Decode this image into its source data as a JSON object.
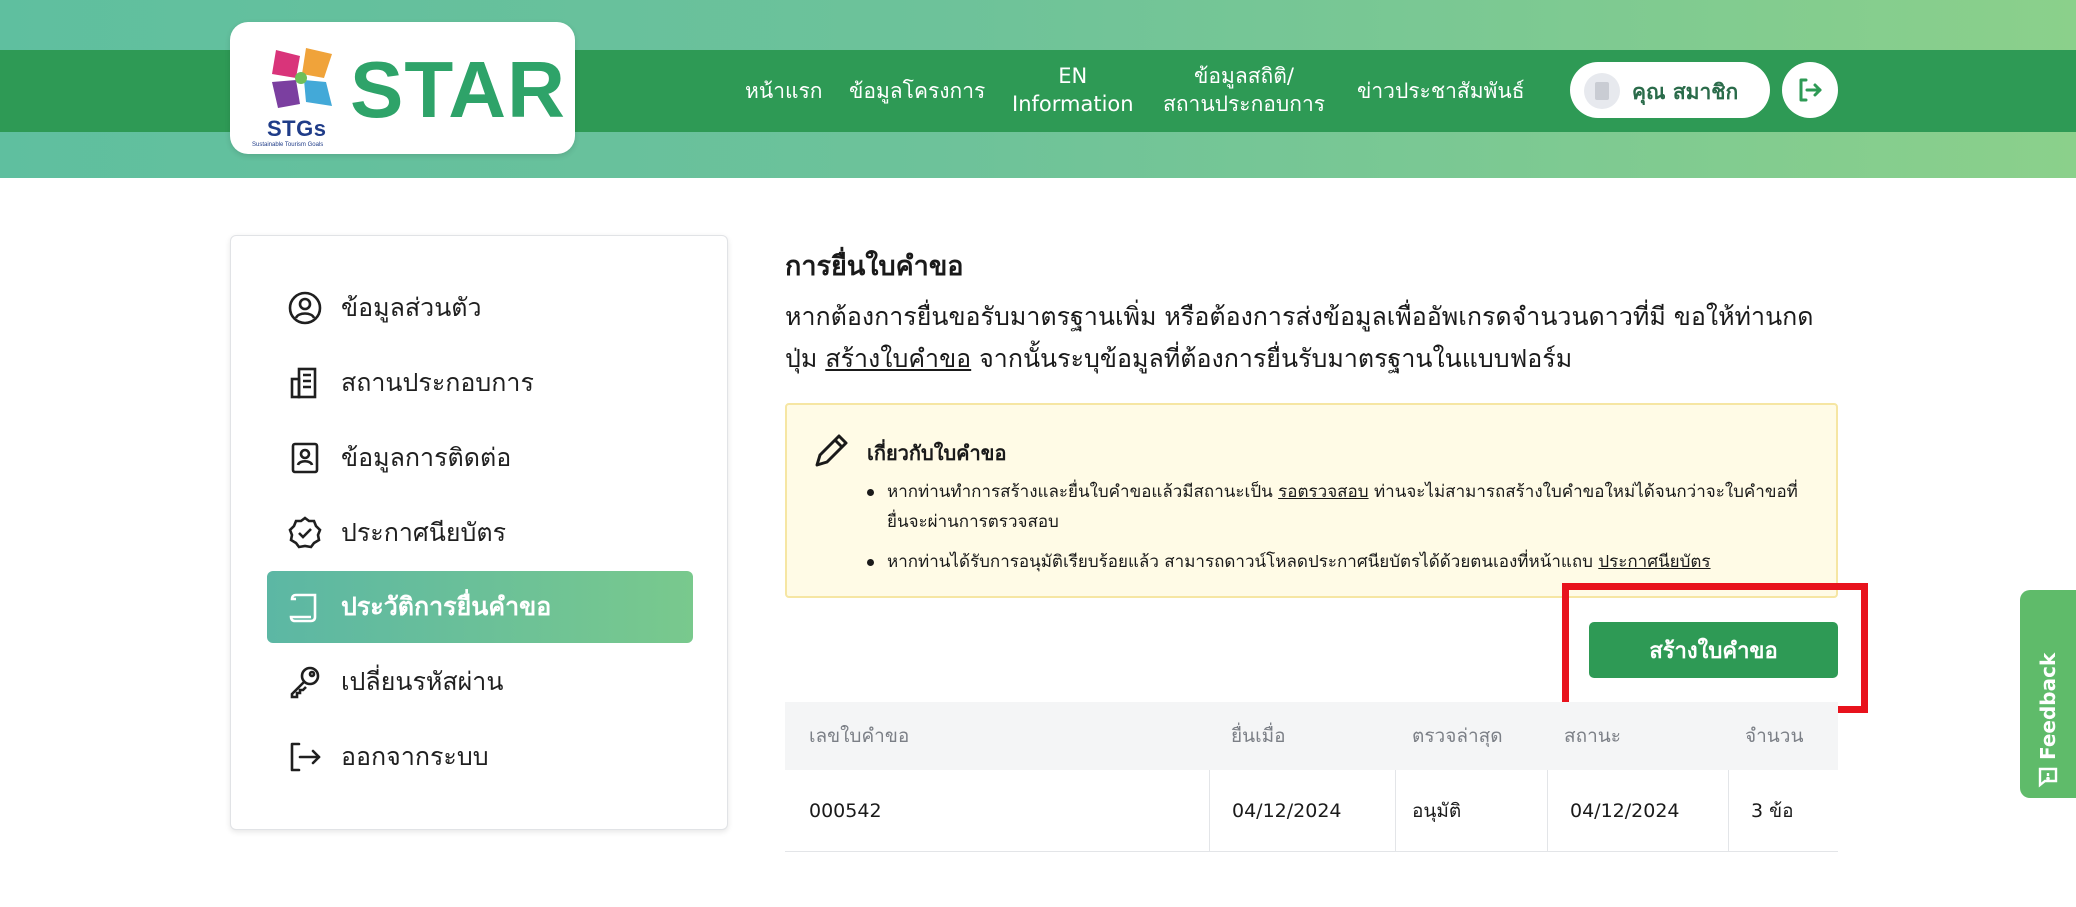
{
  "colors": {
    "brand_green": "#2e9a55",
    "active_gradient_start": "#5cb7a4",
    "highlight_red": "#e8121c",
    "notice_bg": "#fffbe6"
  },
  "logo": {
    "brand_text": "STAR",
    "sub_text": "STGs",
    "tagline": "Sustainable Tourism Goals"
  },
  "nav": {
    "home": "หน้าแรก",
    "project_info": "ข้อมูลโครงการ",
    "en_line1": "EN",
    "en_line2": "Information",
    "stats_line1": "ข้อมูลสถิติ/",
    "stats_line2": "สถานประกอบการ",
    "news": "ข่าวประชาสัมพันธ์"
  },
  "user": {
    "name": "คุณ สมาชิก",
    "avatar_icon": "id-card-icon",
    "logout_icon": "logout-icon"
  },
  "sidebar": {
    "items": [
      {
        "label": "ข้อมูลส่วนตัว",
        "icon": "user-circle-icon"
      },
      {
        "label": "สถานประกอบการ",
        "icon": "building-icon"
      },
      {
        "label": "ข้อมูลการติดต่อ",
        "icon": "contact-book-icon"
      },
      {
        "label": "ประกาศนียบัตร",
        "icon": "certificate-badge-icon"
      },
      {
        "label": "ประวัติการยื่นคำขอ",
        "icon": "scroll-icon",
        "active": true
      },
      {
        "label": "เปลี่ยนรหัสผ่าน",
        "icon": "key-icon"
      },
      {
        "label": "ออกจากระบบ",
        "icon": "logout-icon"
      }
    ]
  },
  "main": {
    "title": "การยื่นใบคำขอ",
    "desc_part1": "หากต้องการยื่นขอรับมาตรฐานเพิ่ม หรือต้องการส่งข้อมูลเพื่ออัพเกรดจำนวนดาวที่มี ขอให้ท่านกดปุ่ม",
    "desc_link": "สร้างใบคำขอ",
    "desc_part2": " จากนั้นระบุข้อมูลที่ต้องการยื่นรับมาตรฐานในแบบฟอร์ม"
  },
  "notice": {
    "title": "เกี่ยวกับใบคำขอ",
    "item1_a": "หากท่านทำการสร้างและยื่นใบคำขอแล้วมีสถานะเป็น ",
    "item1_link": "รอตรวจสอบ",
    "item1_b": " ท่านจะไม่สามารถสร้างใบคำขอใหม่ได้จนกว่าจะใบคำขอที่ยื่นจะผ่านการตรวจสอบ",
    "item2_a": "หากท่านได้รับการอนุมัติเรียบร้อยแล้ว สามารถดาวน์โหลดประกาศนียบัตรได้ด้วยตนเองที่หน้าแถบ ",
    "item2_link": "ประกาศนียบัตร"
  },
  "create_button": "สร้างใบคำขอ",
  "table": {
    "headers": [
      "เลขใบคำขอ",
      "ยื่นเมื่อ",
      "ตรวจล่าสุด",
      "สถานะ",
      "จำนวน"
    ],
    "rows": [
      [
        "000542",
        "04/12/2024",
        "อนุมัติ",
        "04/12/2024",
        "3 ข้อ"
      ]
    ]
  },
  "feedback": {
    "label": "Feedback"
  }
}
